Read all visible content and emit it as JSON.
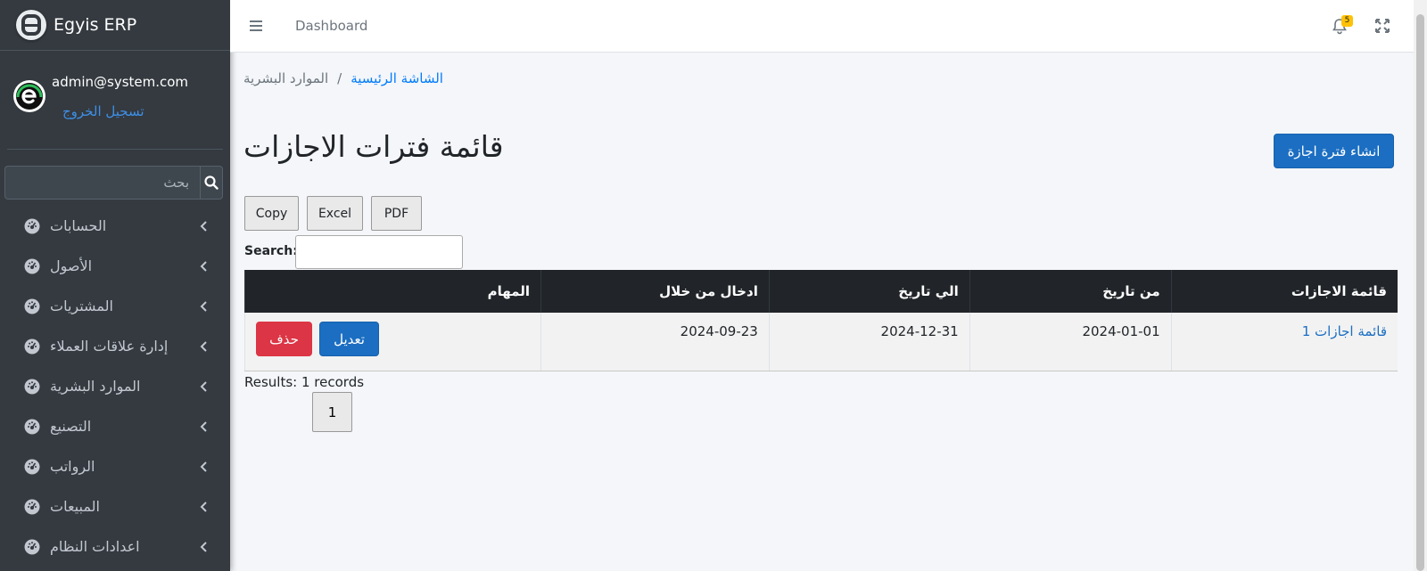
{
  "brand": {
    "name": "Egyis ERP"
  },
  "user": {
    "email": "admin@system.com",
    "logout_label": "تسجيل الخروج"
  },
  "sidebar_search": {
    "placeholder": "بحث"
  },
  "sidebar": {
    "items": [
      {
        "label": "الحسابات"
      },
      {
        "label": "الأصول"
      },
      {
        "label": "المشتريات"
      },
      {
        "label": "إدارة علاقات العملاء"
      },
      {
        "label": "الموارد البشرية"
      },
      {
        "label": "التصنيع"
      },
      {
        "label": "الرواتب"
      },
      {
        "label": "المبيعات"
      },
      {
        "label": "اعدادات النظام"
      }
    ]
  },
  "topbar": {
    "link": "Dashboard",
    "notification_count": "5"
  },
  "breadcrumb": {
    "home": "الشاشة الرئيسية",
    "separator": "/",
    "current": "الموارد البشرية"
  },
  "page": {
    "title": "قائمة فترات الاجازات",
    "create_label": "انشاء فترة اجازة"
  },
  "export_buttons": {
    "copy": "Copy",
    "excel": "Excel",
    "pdf": "PDF"
  },
  "table_search": {
    "label": "Search:"
  },
  "table": {
    "columns": [
      "قائمة الاجازات",
      "من تاريخ",
      "الي تاريخ",
      "ادخال من خلال",
      "المهام"
    ],
    "rows": [
      {
        "list": "قائمة اجازات 1",
        "from": "2024-01-01",
        "to": "2024-12-31",
        "entered": "2024-09-23",
        "edit": "تعديل",
        "delete": "حذف"
      }
    ]
  },
  "footer": {
    "results": "Results: 1 records",
    "page": "1"
  }
}
